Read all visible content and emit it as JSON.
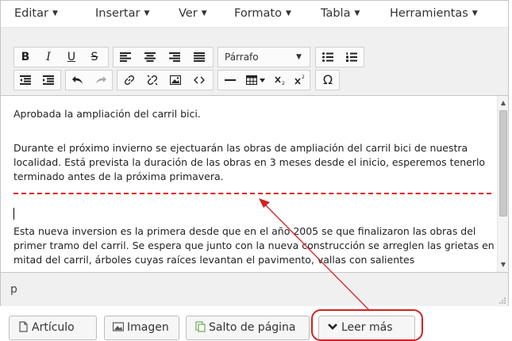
{
  "menubar": {
    "items": [
      {
        "label": "Editar",
        "arrow": "▼"
      },
      {
        "label": "Insertar",
        "arrow": "▼"
      },
      {
        "label": "Ver",
        "arrow": "▼"
      },
      {
        "label": "Formato",
        "arrow": "▼"
      },
      {
        "label": "Tabla",
        "arrow": "▼"
      },
      {
        "label": "Herramientas",
        "arrow": "▼"
      }
    ]
  },
  "toolbar": {
    "bold": "B",
    "italic": "I",
    "underline": "U",
    "strikethrough": "S",
    "format_select": "Párrafo",
    "format_arrow": "▼",
    "special_char": "Ω"
  },
  "content": {
    "paragraph_1": "Aprobada la ampliación del carril bici.",
    "paragraph_2": "Durante el próximo invierno se ejectuarán las obras de ampliación del carril bici de nuestra localidad. Está prevista la duración de las obras en 3 meses desde el inicio, esperemos tenerlo terminado antes de la próxima primavera.",
    "paragraph_3": "Esta nueva inversion es la primera desde que en el año 2005 se que finalizaron las obras del primer tramo del carril. Se espera que junto con la nueva construcción se arreglen las grietas en mitad del carril, árboles cuyas raíces levantan el pavimento, vallas con salientes"
  },
  "status": {
    "path": "p"
  },
  "buttons": {
    "article": "Artículo",
    "image": "Imagen",
    "page_break": "Salto de página",
    "read_more": "Leer más"
  },
  "colors": {
    "highlight": "#d42020",
    "pagebreak_line": "#e01010"
  }
}
